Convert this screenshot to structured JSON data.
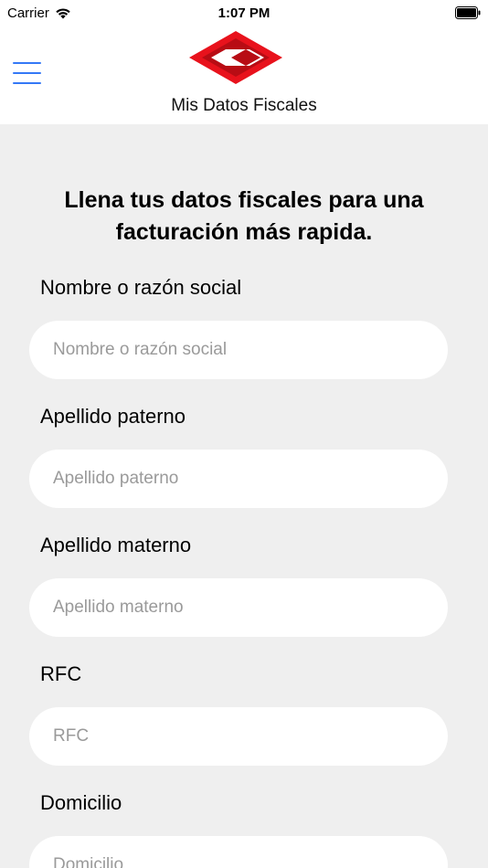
{
  "status_bar": {
    "carrier": "Carrier",
    "time": "1:07 PM"
  },
  "nav": {
    "title": "Mis Datos Fiscales",
    "menu_icon": "hamburger-menu-icon",
    "logo_color": "#e8121c"
  },
  "form": {
    "headline": "Llena tus datos fiscales para una facturación más rapida.",
    "fields": [
      {
        "label": "Nombre o razón social",
        "placeholder": "Nombre o razón social",
        "value": ""
      },
      {
        "label": "Apellido paterno",
        "placeholder": "Apellido paterno",
        "value": ""
      },
      {
        "label": "Apellido materno",
        "placeholder": "Apellido materno",
        "value": ""
      },
      {
        "label": "RFC",
        "placeholder": "RFC",
        "value": ""
      },
      {
        "label": "Domicilio",
        "placeholder": "Domicilio",
        "value": ""
      }
    ]
  },
  "colors": {
    "accent": "#3478f6",
    "background": "#efefef"
  }
}
